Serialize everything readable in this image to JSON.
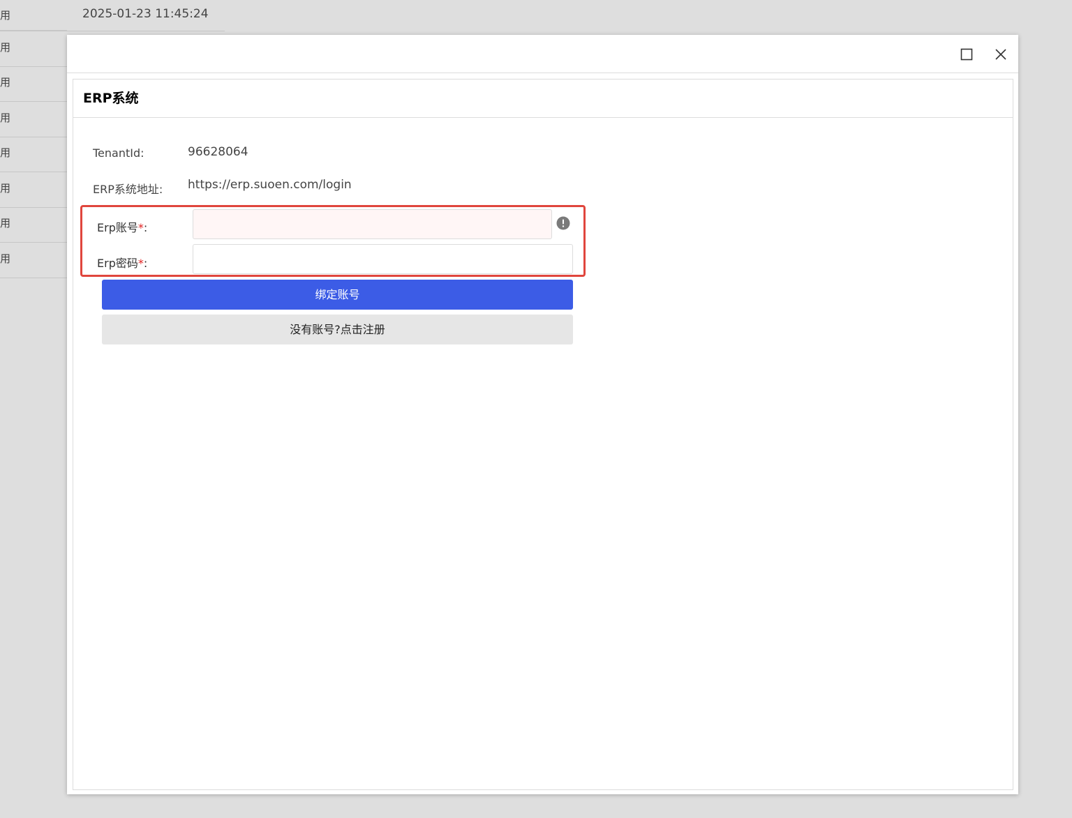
{
  "background": {
    "timestamp": "2025-01-23 11:45:24",
    "rows": [
      "用",
      "用",
      "用",
      "用",
      "用",
      "用",
      "用",
      "用"
    ]
  },
  "dialog": {
    "panel_title": "ERP系统",
    "tenant_label": "TenantId:",
    "tenant_value": "96628064",
    "address_label": "ERP系统地址:",
    "address_value": "https://erp.suoen.com/login",
    "account_label": "Erp账号",
    "password_label": "Erp密码",
    "required_mark": "*",
    "colon": ":",
    "account_value": "",
    "password_value": "",
    "bind_button": "绑定账号",
    "register_button": "没有账号?点击注册"
  },
  "colors": {
    "primary": "#3c5ce6",
    "highlight": "#e0463d",
    "required": "#e02020"
  },
  "icons": {
    "maximize": "maximize-icon",
    "close": "close-icon",
    "warning": "warning-icon"
  }
}
